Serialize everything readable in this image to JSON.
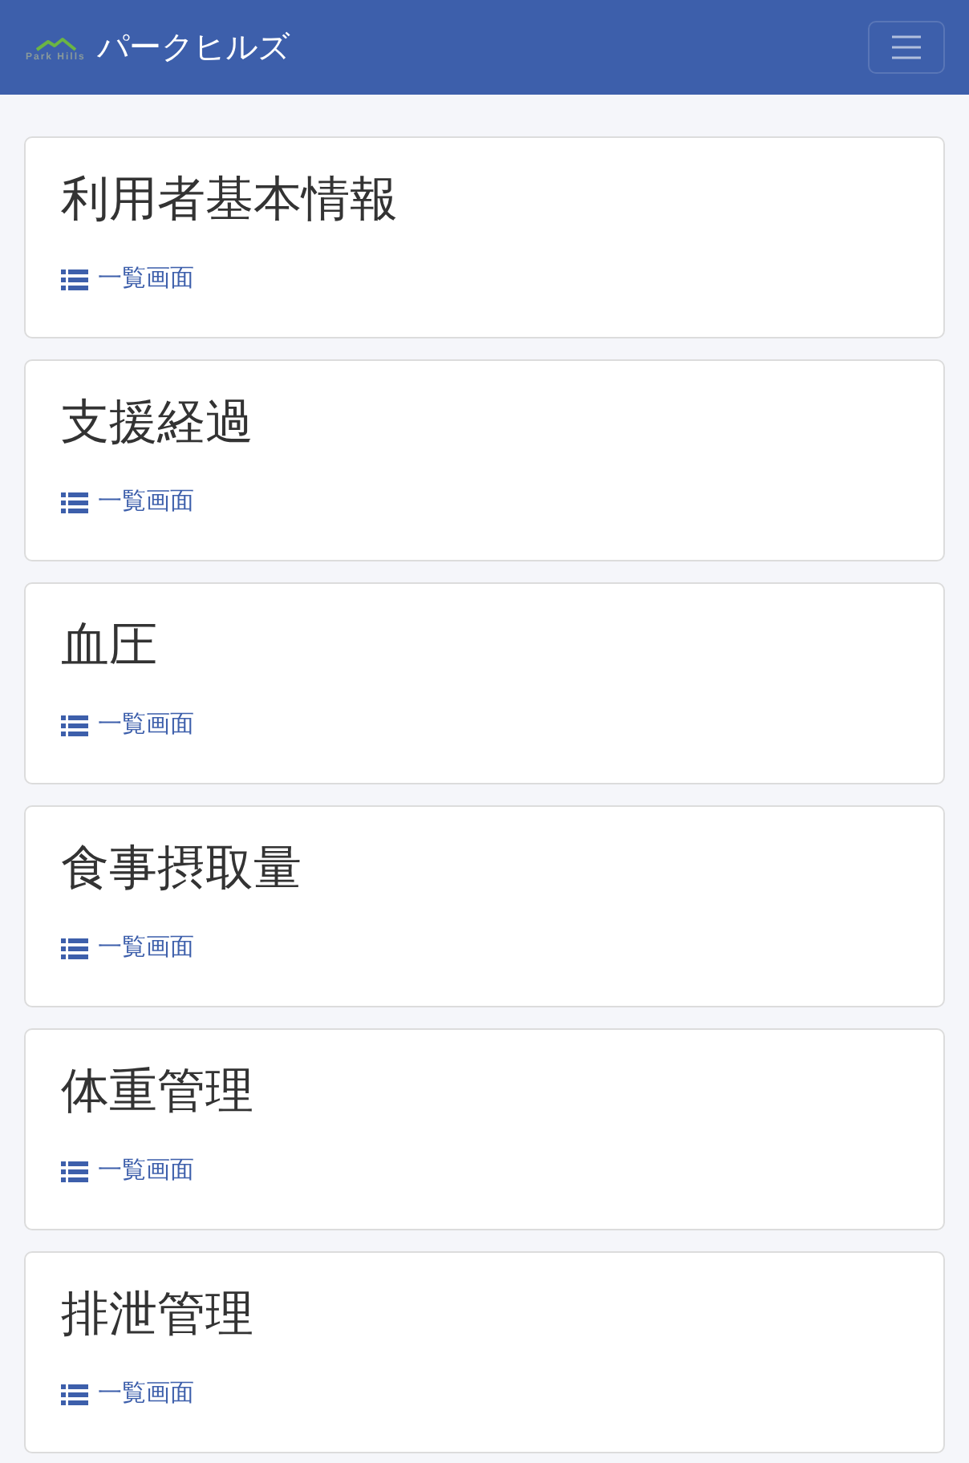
{
  "header": {
    "logo_text": "Park Hills",
    "brand": "パークヒルズ"
  },
  "cards": [
    {
      "title": "利用者基本情報",
      "link": "一覧画面"
    },
    {
      "title": "支援経過",
      "link": "一覧画面"
    },
    {
      "title": "血圧",
      "link": "一覧画面"
    },
    {
      "title": "食事摂取量",
      "link": "一覧画面"
    },
    {
      "title": "体重管理",
      "link": "一覧画面"
    },
    {
      "title": "排泄管理",
      "link": "一覧画面"
    }
  ]
}
